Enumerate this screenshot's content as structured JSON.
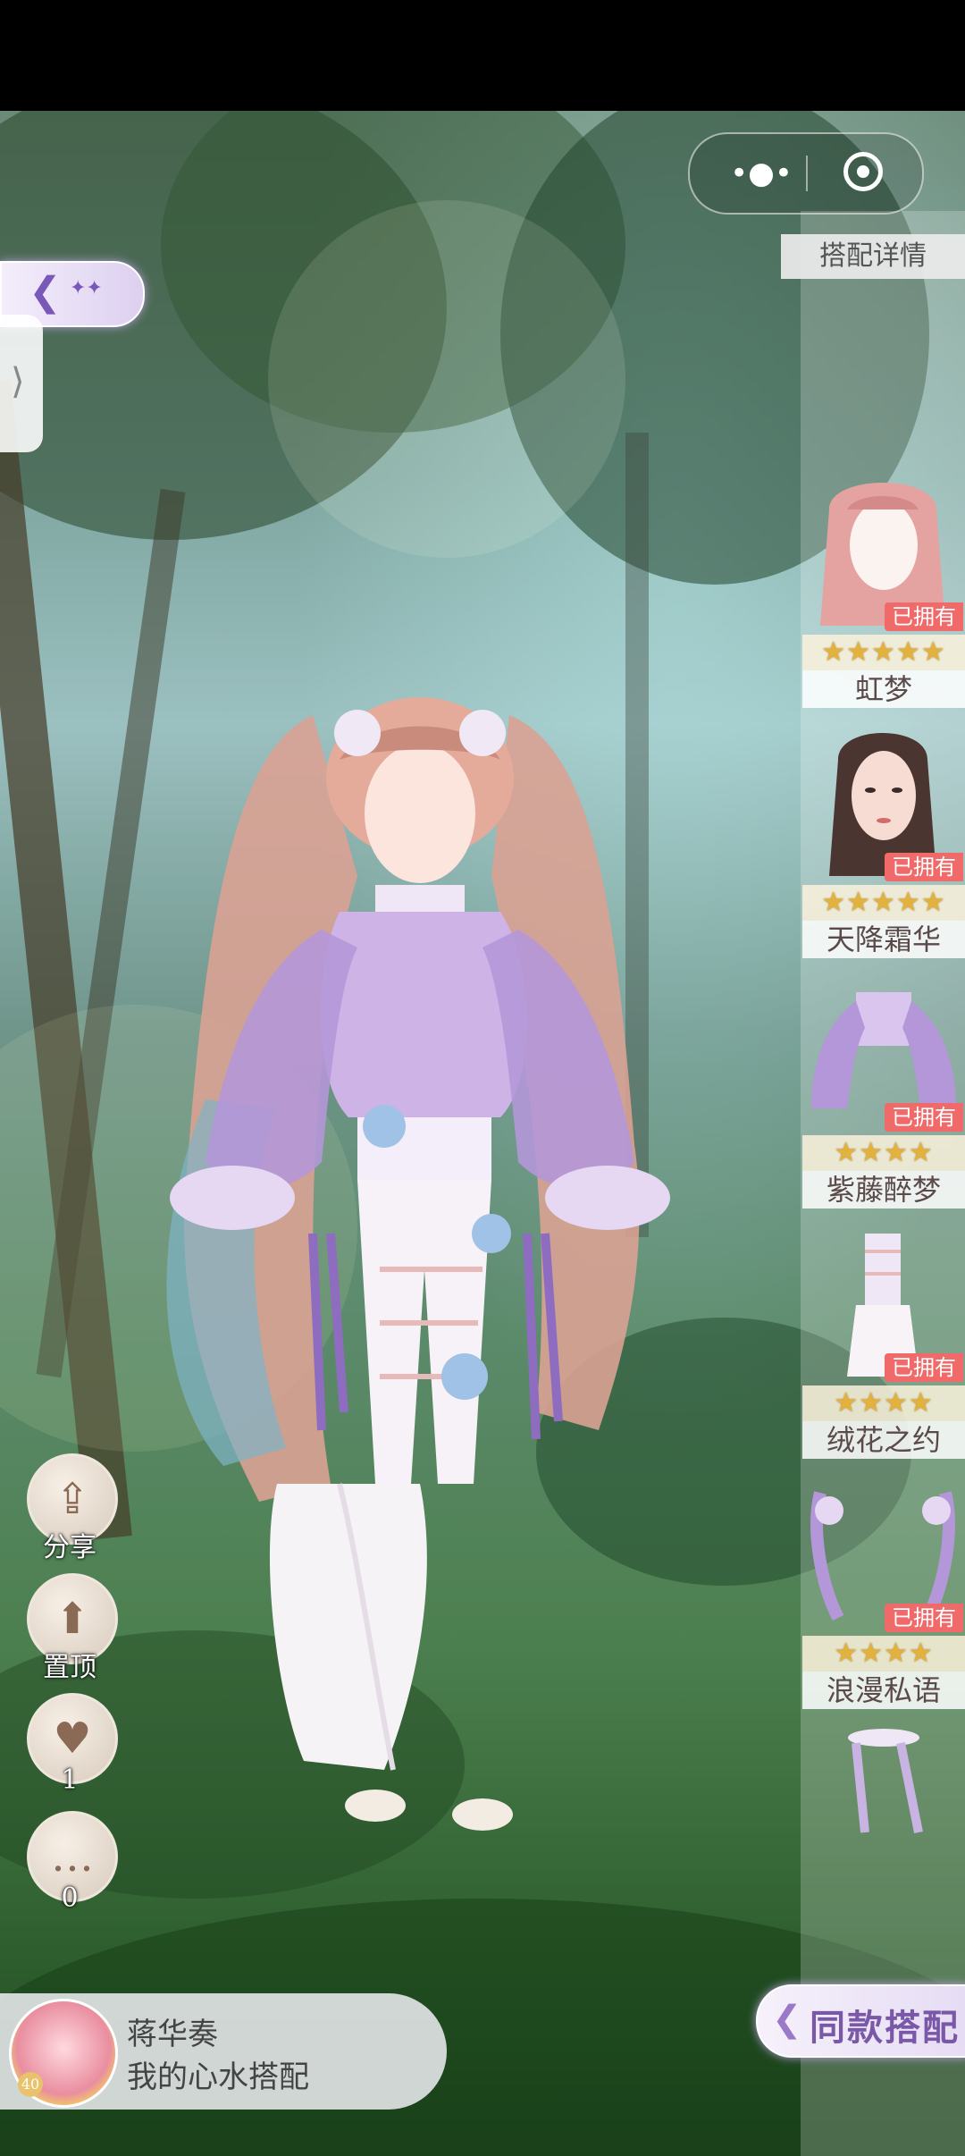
{
  "panel": {
    "title": "搭配详情"
  },
  "items": [
    {
      "name": "虹梦",
      "badge": "已拥有",
      "stars": "★★★★★",
      "star_count": 5
    },
    {
      "name": "天降霜华",
      "badge": "已拥有",
      "stars": "★★★★★",
      "star_count": 5
    },
    {
      "name": "紫藤醉梦",
      "badge": "已拥有",
      "stars": "★★★★",
      "star_count": 4
    },
    {
      "name": "绒花之约",
      "badge": "已拥有",
      "stars": "★★★★",
      "star_count": 4
    },
    {
      "name": "浪漫私语",
      "badge": "已拥有",
      "stars": "★★★★",
      "star_count": 4
    }
  ],
  "actions": {
    "share_label": "分享",
    "pin_label": "置顶",
    "like_count": "1",
    "comment_count": "0"
  },
  "user": {
    "name": "蒋华奏",
    "caption": "我的心水搭配",
    "level": "40"
  },
  "same_outfit_label": "同款搭配",
  "capsule": {
    "more_glyph": "•●•"
  },
  "colors": {
    "badge": "#f06a6a",
    "accent": "#7a58b8",
    "star": "#e3b23c"
  }
}
